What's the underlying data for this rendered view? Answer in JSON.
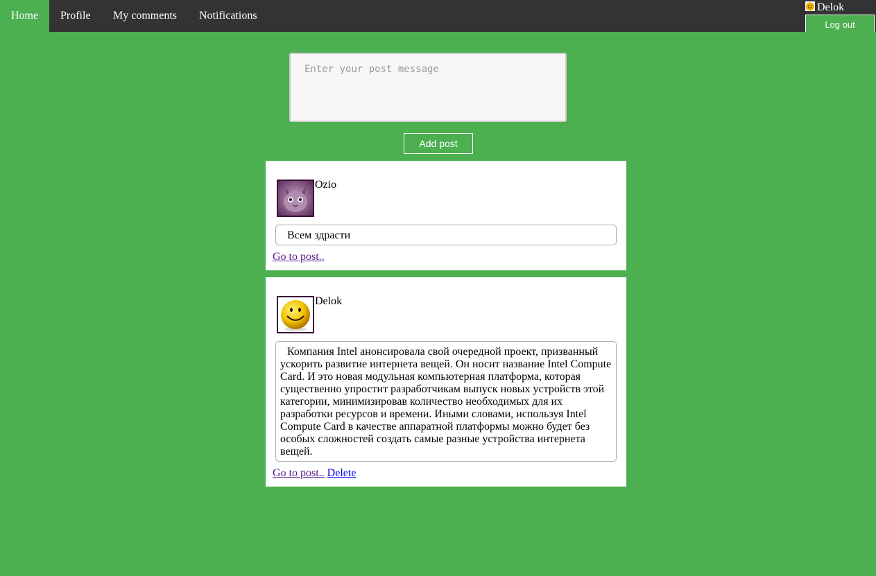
{
  "nav": {
    "items": [
      {
        "label": "Home",
        "active": true
      },
      {
        "label": "Profile"
      },
      {
        "label": "My comments"
      },
      {
        "label": "Notifications"
      }
    ]
  },
  "user": {
    "name": "Delok",
    "avatar_icon": "smiley-avatar",
    "logout_label": "Log out"
  },
  "composer": {
    "placeholder": "Enter your post message",
    "value": ""
  },
  "add_post_label": "Add post",
  "posts": [
    {
      "author": "Ozio",
      "avatar_icon": "cat-avatar",
      "text": "Всем здрасти",
      "goto_label": "Go to post.."
    },
    {
      "author": "Delok",
      "avatar_icon": "smiley-avatar",
      "text": "Компания Intel анонсировала свой очередной проект, призванный ускорить развитие интернета вещей. Он носит название Intel Compute Card. И это новая модульная компьютерная платформа, которая существенно упростит разработчикам выпуск новых устройств этой категории, минимизировав количество необходимых для их разработки ресурсов и времени. Иными словами, используя Intel Compute Card в качестве аппаратной платформы можно будет без особых сложностей создать самые разные устройства интернета вещей.",
      "goto_label": "Go to post..",
      "delete_label": "Delete"
    }
  ],
  "colors": {
    "background": "#4caf50",
    "nav": "#333333",
    "card": "#ffffff"
  }
}
